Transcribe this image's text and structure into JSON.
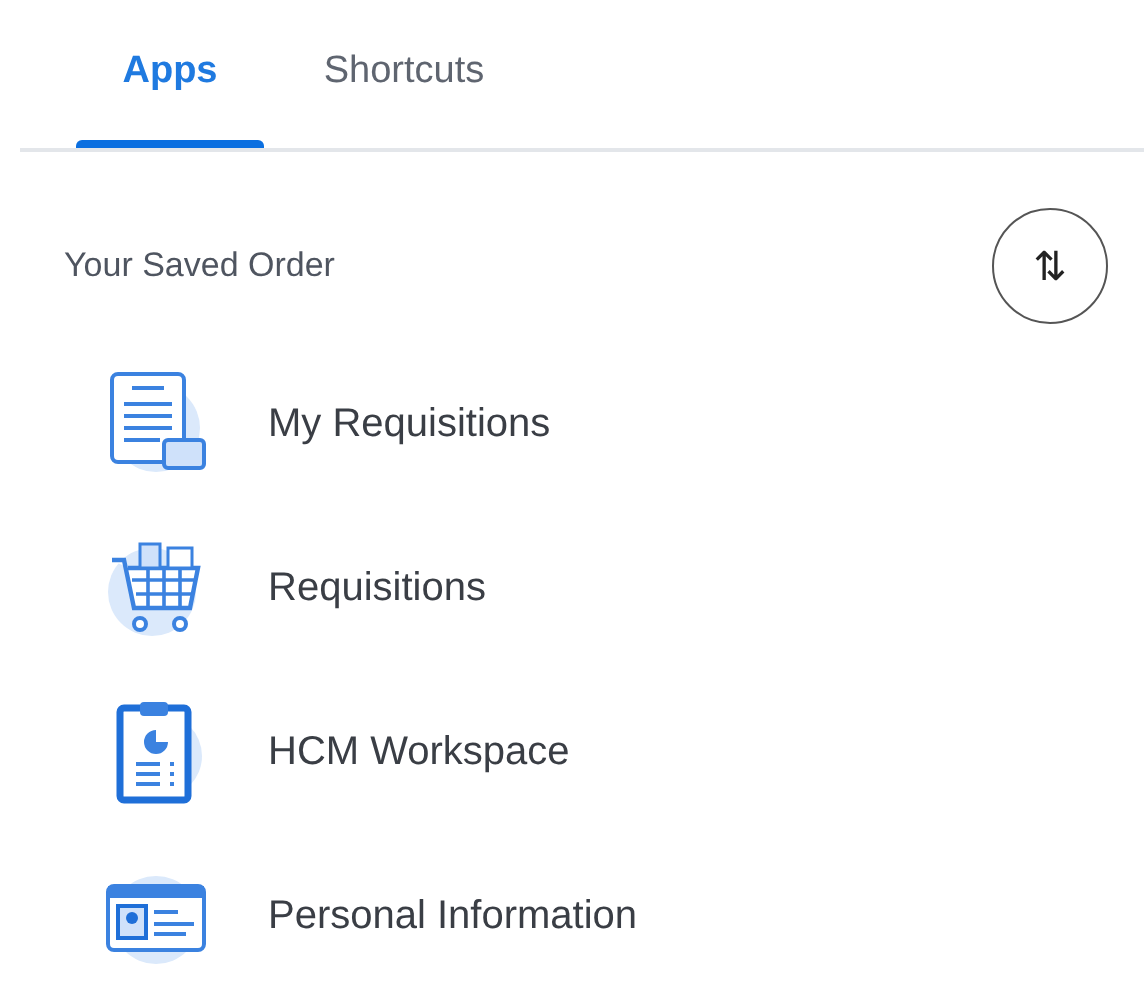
{
  "tabs": [
    {
      "label": "Apps",
      "selected": true
    },
    {
      "label": "Shortcuts",
      "selected": false
    }
  ],
  "section": {
    "title": "Your Saved Order",
    "sort_button": "⇅"
  },
  "apps": [
    {
      "label": "My Requisitions",
      "kind": "document"
    },
    {
      "label": "Requisitions",
      "kind": "cart"
    },
    {
      "label": "HCM Workspace",
      "kind": "clipboard"
    },
    {
      "label": "Personal Information",
      "kind": "idcard"
    }
  ]
}
